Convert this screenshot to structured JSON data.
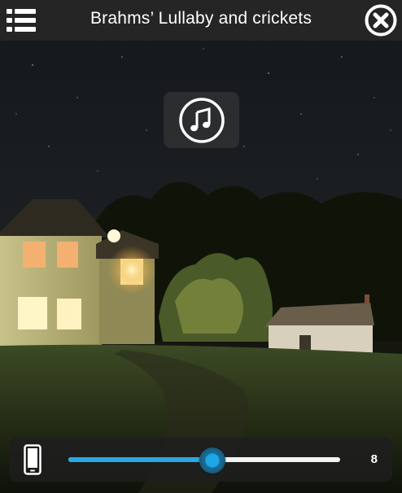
{
  "header": {
    "title": "Brahms’ Lullaby and crickets",
    "menu_icon": "list-menu-icon",
    "close_icon": "close-circle-icon"
  },
  "center": {
    "icon": "music-note-icon"
  },
  "volume": {
    "device_icon": "phone-icon",
    "level_fraction": 0.53,
    "value": "8",
    "accent_color": "#29a8e6"
  }
}
